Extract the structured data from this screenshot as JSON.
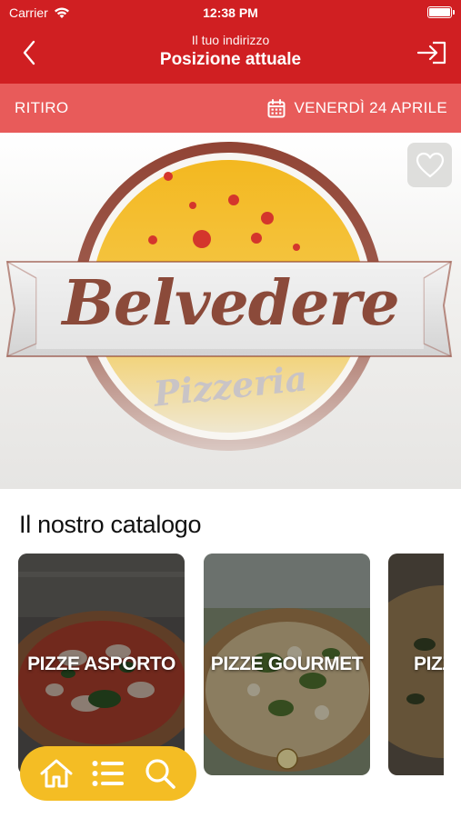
{
  "status_bar": {
    "carrier": "Carrier",
    "time": "12:38 PM"
  },
  "header": {
    "subtitle": "Il tuo indirizzo",
    "title": "Posizione attuale",
    "back_icon": "chevron-left-icon",
    "login_icon": "sign-in-icon"
  },
  "subbar": {
    "mode": "RITIRO",
    "date": "VENERDÌ 24 APRILE",
    "date_icon": "calendar-icon"
  },
  "logo": {
    "name": "Belvedere",
    "tagline": "Pizzeria"
  },
  "catalog": {
    "title": "Il nostro catalogo",
    "items": [
      {
        "label": "PIZZE ASPORTO"
      },
      {
        "label": "PIZZE GOURMET"
      },
      {
        "label": "PIZZ"
      }
    ]
  },
  "bottom_nav": {
    "items": [
      {
        "icon": "home-icon"
      },
      {
        "icon": "list-icon"
      },
      {
        "icon": "search-icon"
      }
    ]
  },
  "colors": {
    "header_red": "#d01f22",
    "subbar_red": "#e85b5a",
    "nav_yellow": "#f4bd24",
    "logo_brown": "#8b3a2a",
    "logo_yellow": "#f3b820"
  }
}
